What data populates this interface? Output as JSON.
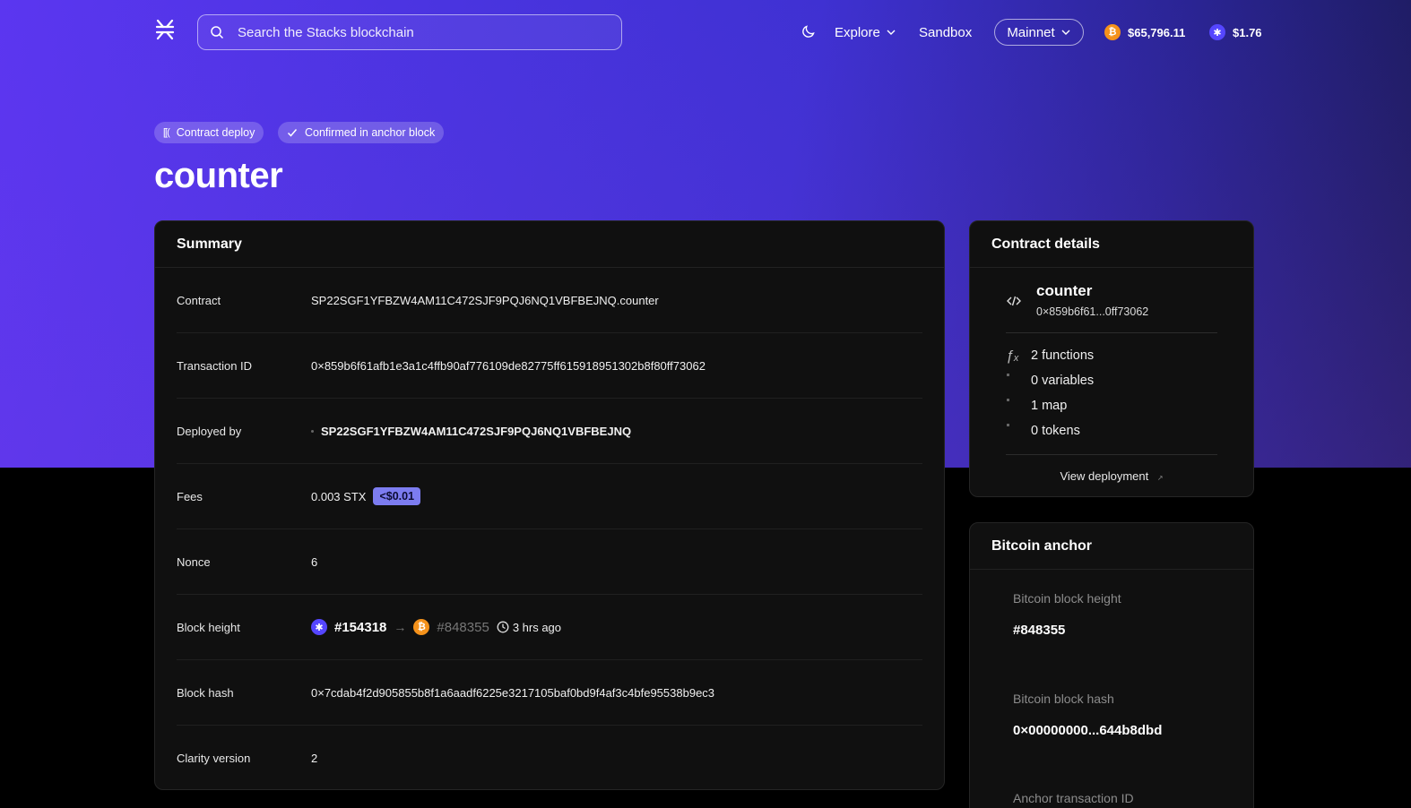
{
  "header": {
    "search_placeholder": "Search the Stacks blockchain",
    "explore_label": "Explore",
    "sandbox_label": "Sandbox",
    "network_label": "Mainnet",
    "btc_price": "$65,796.11",
    "stx_price": "$1.76"
  },
  "badges": {
    "type_label": "Contract deploy",
    "status_label": "Confirmed in anchor block"
  },
  "page_title": "counter",
  "summary": {
    "title": "Summary",
    "rows": [
      {
        "label": "Contract",
        "value": "SP22SGF1YFBZW4AM11C472SJF9PQJ6NQ1VBFBEJNQ.counter"
      },
      {
        "label": "Transaction ID",
        "value": "0×859b6f61afb1e3a1c4ffb90af776109de82775ff615918951302b8f80ff73062"
      },
      {
        "label": "Deployed by",
        "value": "SP22SGF1YFBZW4AM11C472SJF9PQJ6NQ1VBFBEJNQ"
      },
      {
        "label": "Fees",
        "value": "0.003 STX",
        "badge": "<$0.01"
      },
      {
        "label": "Nonce",
        "value": "6"
      },
      {
        "label": "Block height",
        "stx_block": "#154318",
        "btc_block": "#848355",
        "time_ago": "3 hrs ago"
      },
      {
        "label": "Block hash",
        "value": "0×7cdab4f2d905855b8f1a6aadf6225e3217105baf0bd9f4af3c4bfe95538b9ec3"
      },
      {
        "label": "Clarity version",
        "value": "2"
      }
    ]
  },
  "contract_details": {
    "title": "Contract details",
    "name": "counter",
    "tx_short": "0×859b6f61...0ff73062",
    "functions": "2 functions",
    "variables": "0 variables",
    "maps": "1 map",
    "tokens": "0 tokens",
    "view_deployment": "View deployment"
  },
  "bitcoin_anchor": {
    "title": "Bitcoin anchor",
    "block_height_label": "Bitcoin block height",
    "block_height_value": "#848355",
    "block_hash_label": "Bitcoin block hash",
    "block_hash_value": "0×00000000...644b8dbd",
    "anchor_tx_label": "Anchor transaction ID"
  },
  "colors": {
    "hero_start": "#5b36f0",
    "hero_end": "#1b1a55",
    "btc": "#f5921b",
    "stx": "#5546ff",
    "usd_badge": "#7c7cf0"
  }
}
